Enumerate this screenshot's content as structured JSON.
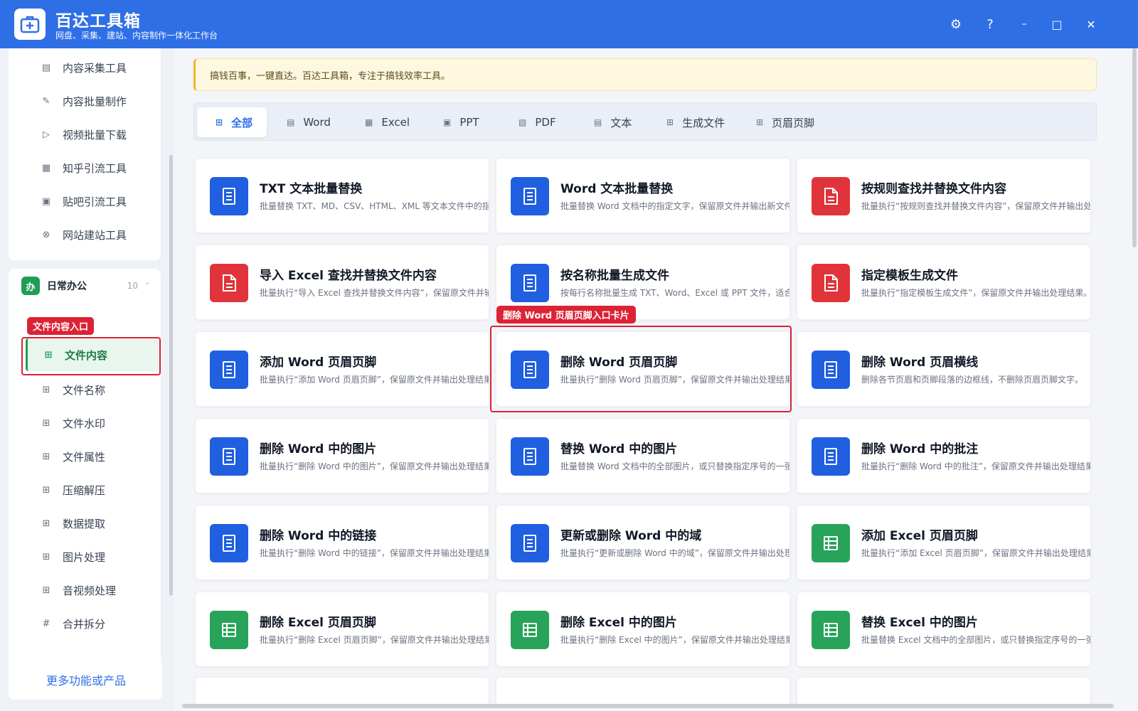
{
  "app": {
    "title": "百达工具箱",
    "subtitle": "网盘、采集、建站、内容制作一体化工作台"
  },
  "window_controls": {
    "settings": "⚙",
    "help": "?",
    "minimize": "–",
    "maximize": "□",
    "close": "✕"
  },
  "sidebar": {
    "top_items": [
      {
        "label": "内容采集工具",
        "icon": "collect-icon"
      },
      {
        "label": "内容批量制作",
        "icon": "pen-icon"
      },
      {
        "label": "视频批量下载",
        "icon": "video-icon"
      },
      {
        "label": "知乎引流工具",
        "icon": "zhihu-icon"
      },
      {
        "label": "贴吧引流工具",
        "icon": "tieba-icon"
      },
      {
        "label": "网站建站工具",
        "icon": "site-icon"
      }
    ],
    "group": {
      "badge": "办",
      "title": "日常办公",
      "count": "10",
      "caret": "˄"
    },
    "group_items": [
      {
        "label": "文件内容",
        "icon": "grid-icon",
        "active": true
      },
      {
        "label": "文件名称",
        "icon": "grid-icon"
      },
      {
        "label": "文件水印",
        "icon": "grid-icon"
      },
      {
        "label": "文件属性",
        "icon": "grid-icon"
      },
      {
        "label": "压缩解压",
        "icon": "grid-icon"
      },
      {
        "label": "数据提取",
        "icon": "grid-icon"
      },
      {
        "label": "图片处理",
        "icon": "grid-icon"
      },
      {
        "label": "音视频处理",
        "icon": "grid-icon"
      },
      {
        "label": "合并拆分",
        "icon": "hash-icon"
      }
    ],
    "highlight_tag": "文件内容入口",
    "more_button": "更多功能或产品"
  },
  "notice": "搞钱百事，一键直达。百达工具箱，专注于搞钱效率工具。",
  "tabs": [
    {
      "label": "全部",
      "active": true
    },
    {
      "label": "Word"
    },
    {
      "label": "Excel"
    },
    {
      "label": "PPT"
    },
    {
      "label": "PDF"
    },
    {
      "label": "文本"
    },
    {
      "label": "生成文件"
    },
    {
      "label": "页眉页脚"
    }
  ],
  "cards": [
    {
      "title": "TXT 文本批量替换",
      "desc": "批量替换 TXT、MD、CSV、HTML、XML 等文本文件中的指定内容",
      "color": "blue",
      "icon": "doc-icon"
    },
    {
      "title": "Word 文本批量替换",
      "desc": "批量替换 Word 文档中的指定文字，保留原文件并输出新文件。",
      "color": "blue",
      "icon": "doc-icon"
    },
    {
      "title": "按规则查找并替换文件内容",
      "desc": "批量执行“按规则查找并替换文件内容”，保留原文件并输出处理结果。",
      "color": "red",
      "icon": "file-icon"
    },
    {
      "title": "导入 Excel 查找并替换文件内容",
      "desc": "批量执行“导入 Excel 查找并替换文件内容”，保留原文件并输出处理结果。",
      "color": "red",
      "icon": "file-icon"
    },
    {
      "title": "按名称批量生成文件",
      "desc": "按每行名称批量生成 TXT、Word、Excel 或 PPT 文件，适合批量建档。",
      "color": "blue",
      "icon": "doc-icon"
    },
    {
      "title": "指定模板生成文件",
      "desc": "批量执行“指定模板生成文件”，保留原文件并输出处理结果。",
      "color": "red",
      "icon": "file-icon"
    },
    {
      "title": "添加 Word 页眉页脚",
      "desc": "批量执行“添加 Word 页眉页脚”，保留原文件并输出处理结果。",
      "color": "blue",
      "icon": "doc-icon"
    },
    {
      "title": "删除 Word 页眉页脚",
      "desc": "批量执行“删除 Word 页眉页脚”，保留原文件并输出处理结果。",
      "color": "blue",
      "icon": "doc-icon"
    },
    {
      "title": "删除 Word 页眉横线",
      "desc": "删除各节页眉和页脚段落的边框线，不删除页眉页脚文字。",
      "color": "blue",
      "icon": "doc-icon"
    },
    {
      "title": "删除 Word 中的图片",
      "desc": "批量执行“删除 Word 中的图片”，保留原文件并输出处理结果。",
      "color": "blue",
      "icon": "doc-icon"
    },
    {
      "title": "替换 Word 中的图片",
      "desc": "批量替换 Word 文档中的全部图片，或只替换指定序号的一张图片。",
      "color": "blue",
      "icon": "doc-icon"
    },
    {
      "title": "删除 Word 中的批注",
      "desc": "批量执行“删除 Word 中的批注”，保留原文件并输出处理结果。",
      "color": "blue",
      "icon": "doc-icon"
    },
    {
      "title": "删除 Word 中的链接",
      "desc": "批量执行“删除 Word 中的链接”，保留原文件并输出处理结果。",
      "color": "blue",
      "icon": "doc-icon"
    },
    {
      "title": "更新或删除 Word 中的域",
      "desc": "批量执行“更新或删除 Word 中的域”，保留原文件并输出处理结果。",
      "color": "blue",
      "icon": "doc-icon"
    },
    {
      "title": "添加 Excel 页眉页脚",
      "desc": "批量执行“添加 Excel 页眉页脚”，保留原文件并输出处理结果。",
      "color": "green",
      "icon": "sheet-icon"
    },
    {
      "title": "删除 Excel 页眉页脚",
      "desc": "批量执行“删除 Excel 页眉页脚”，保留原文件并输出处理结果。",
      "color": "green",
      "icon": "sheet-icon"
    },
    {
      "title": "删除 Excel 中的图片",
      "desc": "批量执行“删除 Excel 中的图片”，保留原文件并输出处理结果。",
      "color": "green",
      "icon": "sheet-icon"
    },
    {
      "title": "替换 Excel 中的图片",
      "desc": "批量替换 Excel 文档中的全部图片，或只替换指定序号的一张图片。",
      "color": "green",
      "icon": "sheet-icon"
    }
  ],
  "highlight_card_tag": "删除 Word 页眉页脚入口卡片",
  "colors": {
    "brand": "#2f6fe6",
    "highlight": "#dc2335",
    "blue": "#1f5fe0",
    "red": "#e0343a",
    "green": "#27a35a"
  }
}
